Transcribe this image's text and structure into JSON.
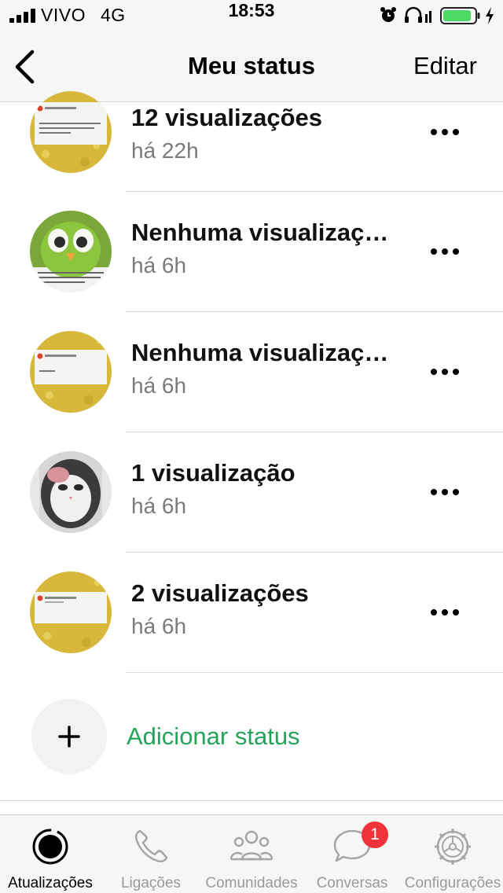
{
  "status_bar": {
    "carrier": "VIVO",
    "network": "4G",
    "time": "18:53",
    "battery_color": "#4cd964"
  },
  "nav": {
    "back_icon": "chevron-left-icon",
    "title": "Meu status",
    "edit_label": "Editar"
  },
  "status_list": [
    {
      "title": "12 visualizações",
      "time": "há 22h",
      "thumb": "yellow-card"
    },
    {
      "title": "Nenhuma visualização",
      "time": "há 6h",
      "thumb": "green-owl"
    },
    {
      "title": "Nenhuma visualização",
      "time": "há 6h",
      "thumb": "yellow-card"
    },
    {
      "title": "1 visualização",
      "time": "há 6h",
      "thumb": "cat-photo"
    },
    {
      "title": "2 visualizações",
      "time": "há 6h",
      "thumb": "yellow-card"
    }
  ],
  "add_status": {
    "label": "Adicionar status",
    "color": "#25a35a"
  },
  "tabs": [
    {
      "label": "Atualizações",
      "icon": "updates-icon",
      "active": true
    },
    {
      "label": "Ligações",
      "icon": "phone-icon",
      "active": false
    },
    {
      "label": "Comunidades",
      "icon": "communities-icon",
      "active": false
    },
    {
      "label": "Conversas",
      "icon": "chats-icon",
      "active": false,
      "badge": "1"
    },
    {
      "label": "Configurações",
      "icon": "settings-icon",
      "active": false
    }
  ]
}
